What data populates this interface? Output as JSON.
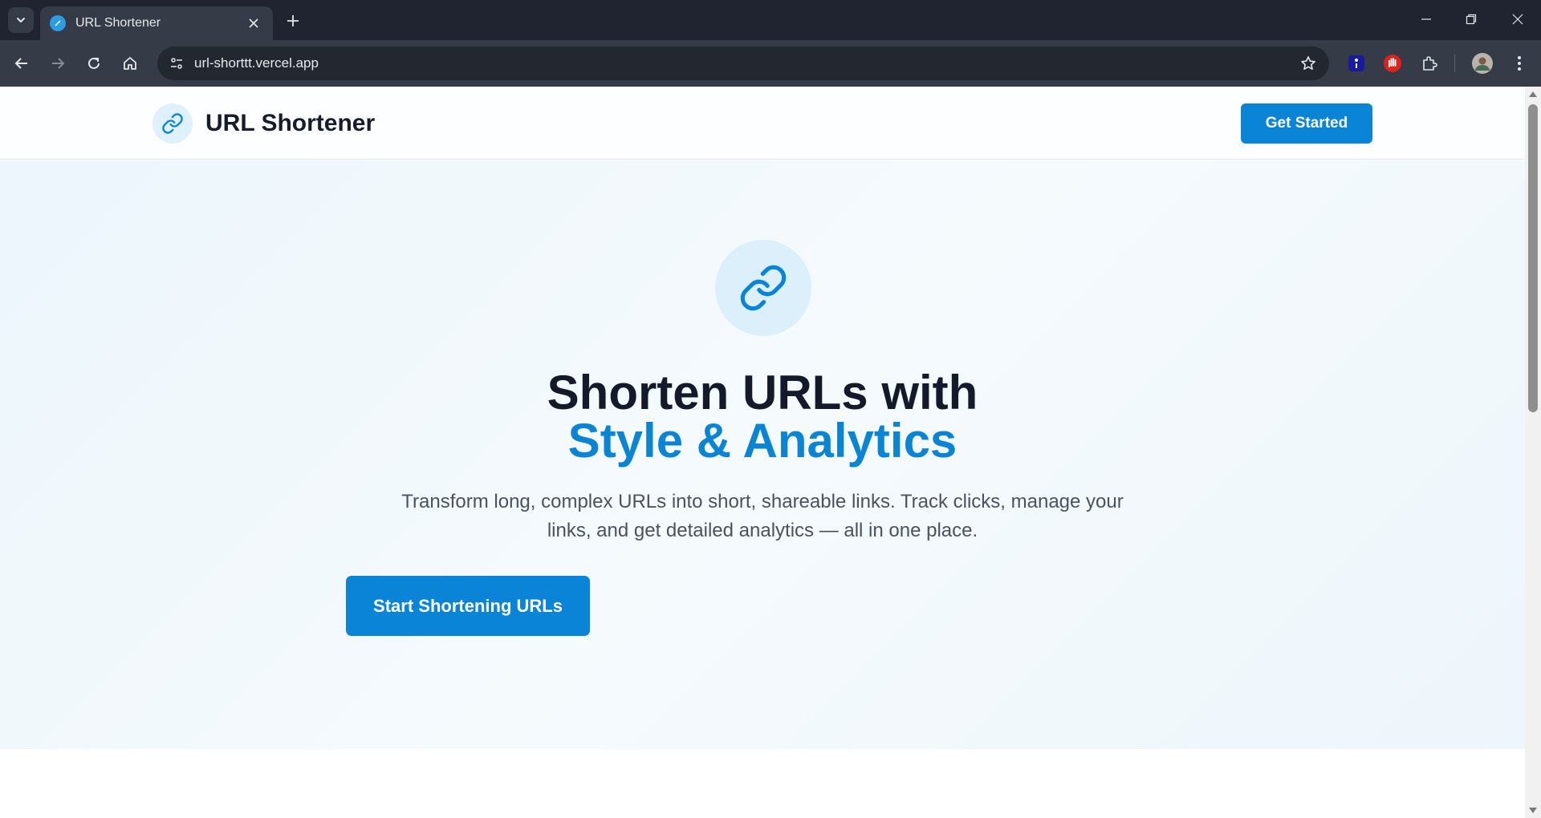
{
  "browser": {
    "tab_title": "URL Shortener",
    "url": "url-shorttt.vercel.app"
  },
  "header": {
    "brand_name": "URL Shortener",
    "cta_label": "Get Started"
  },
  "hero": {
    "title_line1": "Shorten URLs with",
    "title_line2": "Style & Analytics",
    "description": "Transform long, complex URLs into short, shareable links. Track clicks, manage your links, and get detailed analytics — all in one place.",
    "cta_label": "Start Shortening URLs"
  },
  "colors": {
    "accent": "#0a84d6",
    "heading": "#141a2a",
    "body_text": "#4a5261",
    "hero_bg": "#ecf6fc",
    "chrome_bg": "#1f2430"
  },
  "icons": [
    "chevron-down-icon",
    "favicon-icon",
    "close-icon",
    "plus-icon",
    "minimize-icon",
    "restore-icon",
    "back-icon",
    "forward-icon",
    "reload-icon",
    "home-icon",
    "site-info-icon",
    "star-icon",
    "extension-icon",
    "profile-avatar",
    "kebab-menu-icon",
    "link-icon"
  ]
}
